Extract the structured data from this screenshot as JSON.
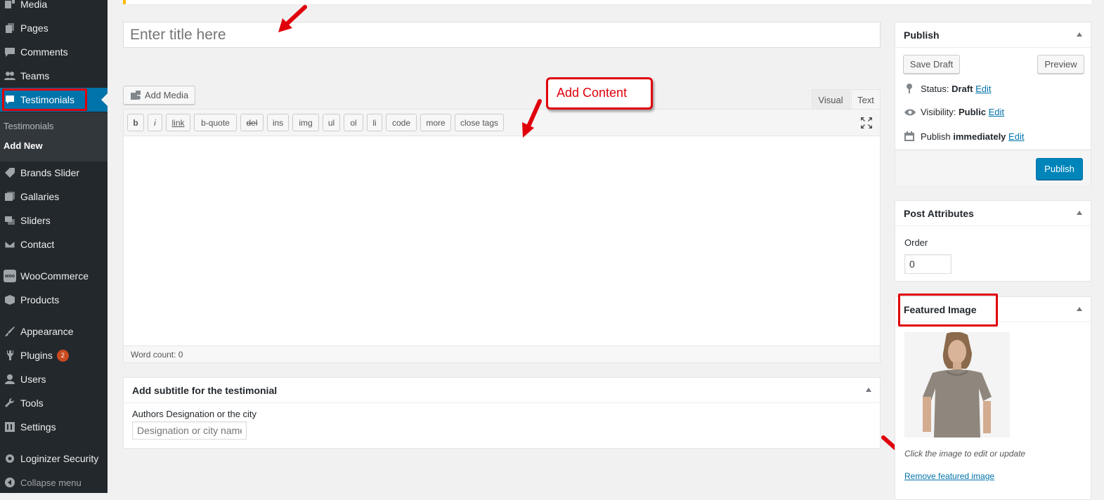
{
  "sidebar": {
    "items": [
      {
        "label": "Media",
        "icon": "media-icon"
      },
      {
        "label": "Pages",
        "icon": "pages-icon"
      },
      {
        "label": "Comments",
        "icon": "comments-icon"
      },
      {
        "label": "Teams",
        "icon": "teams-icon"
      },
      {
        "label": "Testimonials",
        "icon": "testimonials-icon"
      },
      {
        "label": "Brands Slider",
        "icon": "tag-icon"
      },
      {
        "label": "Gallaries",
        "icon": "gallery-icon"
      },
      {
        "label": "Sliders",
        "icon": "sliders-icon"
      },
      {
        "label": "Contact",
        "icon": "envelope-icon"
      },
      {
        "label": "WooCommerce",
        "icon": "woo-icon",
        "icon_text": "woo"
      },
      {
        "label": "Products",
        "icon": "box-icon"
      },
      {
        "label": "Appearance",
        "icon": "brush-icon"
      },
      {
        "label": "Plugins",
        "icon": "plugin-icon",
        "badge": "2"
      },
      {
        "label": "Users",
        "icon": "user-icon"
      },
      {
        "label": "Tools",
        "icon": "wrench-icon"
      },
      {
        "label": "Settings",
        "icon": "settings-icon"
      },
      {
        "label": "Loginizer Security",
        "icon": "gear-icon"
      },
      {
        "label": "Collapse menu",
        "icon": "collapse-icon"
      }
    ],
    "submenu": [
      {
        "label": "Testimonials"
      },
      {
        "label": "Add New"
      }
    ],
    "active_color": "#0073aa"
  },
  "title_field": {
    "placeholder": "Enter title here"
  },
  "editor": {
    "add_media_label": "Add Media",
    "tabs": [
      "Visual",
      "Text"
    ],
    "quicktags": [
      "b",
      "i",
      "link",
      "b-quote",
      "del",
      "ins",
      "img",
      "ul",
      "ol",
      "li",
      "code",
      "more",
      "close tags"
    ],
    "word_count": "Word count: 0"
  },
  "callout": {
    "text": "Add Content",
    "color": "#e0000b"
  },
  "subtitle_box": {
    "title": "Add subtitle for the testimonial",
    "field_label": "Authors Designation or the city",
    "placeholder": "Designation or city name"
  },
  "publish_box": {
    "title": "Publish",
    "save_draft": "Save Draft",
    "preview": "Preview",
    "status_label": "Status:",
    "status_value": "Draft",
    "visibility_label": "Visibility:",
    "visibility_value": "Public",
    "publish_label": "Publish",
    "publish_value": "immediately",
    "edit": "Edit",
    "publish_button": "Publish"
  },
  "attributes_box": {
    "title": "Post Attributes",
    "order_label": "Order",
    "order_value": "0"
  },
  "featured_box": {
    "title": "Featured Image",
    "hint": "Click the image to edit or update",
    "remove_link": "Remove featured image"
  }
}
